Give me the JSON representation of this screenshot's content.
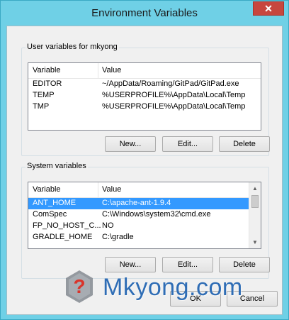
{
  "window": {
    "title": "Environment Variables",
    "close_glyph": "✕"
  },
  "user_vars": {
    "group_label": "User variables for mkyong",
    "columns": [
      "Variable",
      "Value"
    ],
    "rows": [
      {
        "variable": "EDITOR",
        "value": "~/AppData/Roaming/GitPad/GitPad.exe"
      },
      {
        "variable": "TEMP",
        "value": "%USERPROFILE%\\AppData\\Local\\Temp"
      },
      {
        "variable": "TMP",
        "value": "%USERPROFILE%\\AppData\\Local\\Temp"
      }
    ],
    "buttons": {
      "new": "New...",
      "edit": "Edit...",
      "delete": "Delete"
    }
  },
  "system_vars": {
    "group_label": "System variables",
    "columns": [
      "Variable",
      "Value"
    ],
    "rows": [
      {
        "variable": "ANT_HOME",
        "value": "C:\\apache-ant-1.9.4",
        "selected": true
      },
      {
        "variable": "ComSpec",
        "value": "C:\\Windows\\system32\\cmd.exe"
      },
      {
        "variable": "FP_NO_HOST_C...",
        "value": "NO"
      },
      {
        "variable": "GRADLE_HOME",
        "value": "C:\\gradle"
      }
    ],
    "buttons": {
      "new": "New...",
      "edit": "Edit...",
      "delete": "Delete"
    }
  },
  "dialog_buttons": {
    "ok": "OK",
    "cancel": "Cancel"
  },
  "watermark": {
    "text": "Mkyong.com",
    "color": "#2f6db5",
    "icon": "question-mark-logo-icon"
  },
  "colors": {
    "titlebar": "#6fd0e6",
    "close_button": "#c7463e",
    "selection": "#3399ff"
  }
}
